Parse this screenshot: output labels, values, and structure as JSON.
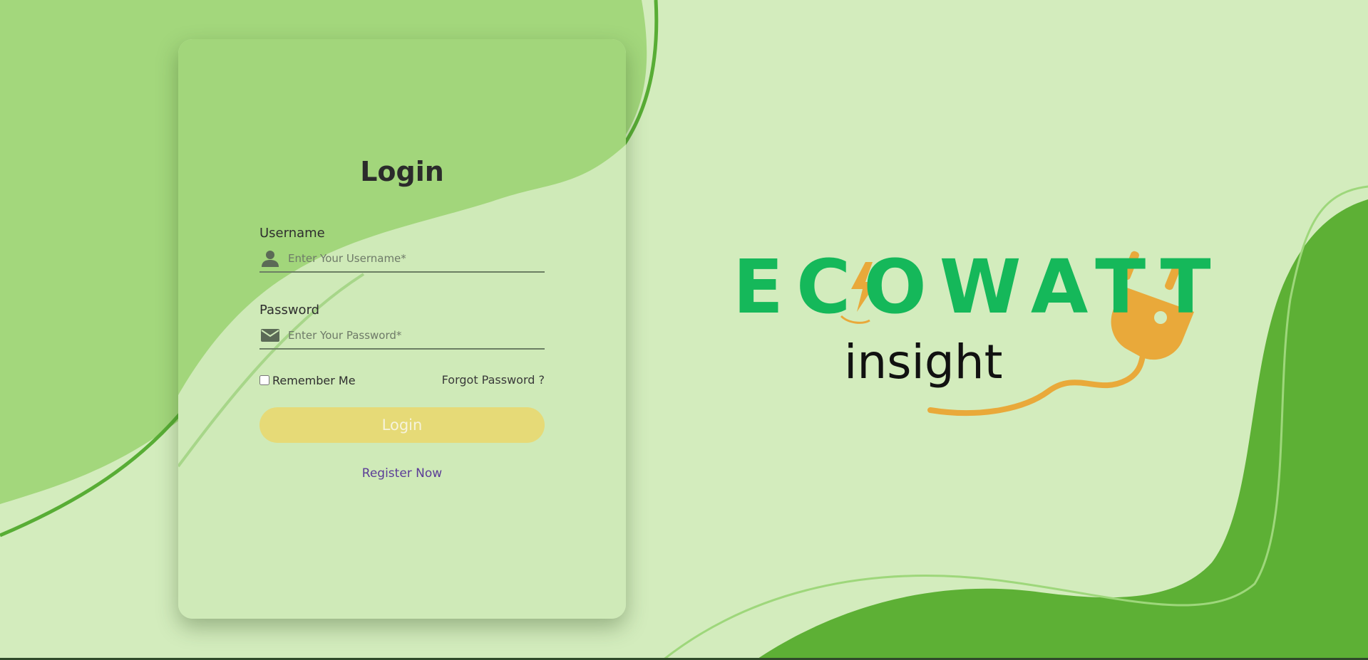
{
  "login": {
    "title": "Login",
    "username": {
      "label": "Username",
      "placeholder": "Enter Your Username*",
      "icon": "user-icon"
    },
    "password": {
      "label": "Password",
      "placeholder": "Enter Your Password*",
      "icon": "mail-icon"
    },
    "remember_label": "Remember Me",
    "forgot_label": "Forgot Password ?",
    "submit_label": "Login",
    "register_label": "Register Now"
  },
  "brand": {
    "wordmark": "ECOWATT",
    "subtitle": "insight",
    "icons": [
      "lightning-bolt-icon",
      "power-plug-icon"
    ]
  },
  "colors": {
    "page_background": "#d3ecbd",
    "card_background": "#cfeab8",
    "accent_green": "#5aaf32",
    "logo_green": "#15b85a",
    "logo_orange": "#e9a93a",
    "button": "#e6da77",
    "register_link": "#5b3c97"
  }
}
